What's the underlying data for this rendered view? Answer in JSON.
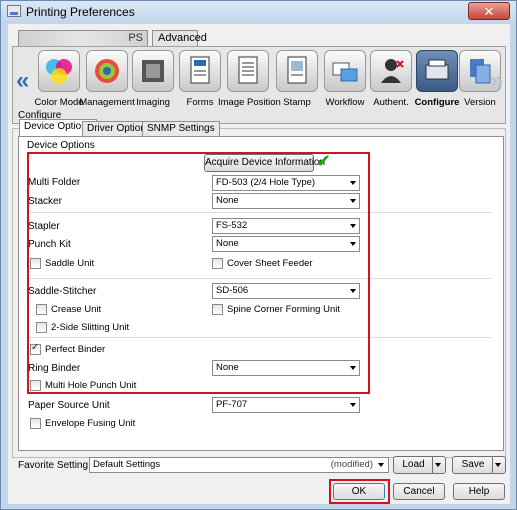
{
  "window": {
    "title": "Printing Preferences",
    "close_glyph": "✕"
  },
  "top_tabs": {
    "blurred_prefix": "",
    "ps_label": "PS",
    "advanced_label": "Advanced"
  },
  "toolbar": {
    "items": [
      {
        "label": "Color Mode",
        "icon": "color-mode-icon"
      },
      {
        "label": "Management",
        "icon": "management-icon"
      },
      {
        "label": "Imaging",
        "icon": "imaging-icon"
      },
      {
        "label": "Forms",
        "icon": "forms-icon"
      },
      {
        "label": "Image Position",
        "icon": "image-position-icon"
      },
      {
        "label": "Stamp",
        "icon": "stamp-icon"
      },
      {
        "label": "Workflow",
        "icon": "workflow-icon"
      },
      {
        "label": "Authent.",
        "icon": "authentication-icon"
      },
      {
        "label": "Configure",
        "icon": "configure-icon",
        "selected": true
      },
      {
        "label": "Version",
        "icon": "version-icon"
      }
    ]
  },
  "configure": {
    "section_label": "Configure",
    "tabs": [
      "Device Options",
      "Driver Options",
      "SNMP Settings"
    ],
    "group_label": "Device Options",
    "acquire_button": "Acquire Device Information",
    "fields": {
      "multi_folder": {
        "label": "Multi Folder",
        "value": "FD-503 (2/4 Hole Type)"
      },
      "stacker": {
        "label": "Stacker",
        "value": "None"
      },
      "stapler": {
        "label": "Stapler",
        "value": "FS-532"
      },
      "punch_kit": {
        "label": "Punch Kit",
        "value": "None"
      },
      "saddle_stitcher": {
        "label": "Saddle-Stitcher",
        "value": "SD-506"
      },
      "ring_binder": {
        "label": "Ring Binder",
        "value": "None"
      },
      "paper_source_unit": {
        "label": "Paper Source Unit",
        "value": "PF-707"
      }
    },
    "checks": {
      "saddle_unit": {
        "label": "Saddle Unit",
        "checked": false
      },
      "cover_sheet_feeder": {
        "label": "Cover Sheet Feeder",
        "checked": false
      },
      "crease_unit": {
        "label": "Crease Unit",
        "checked": false
      },
      "spine_corner": {
        "label": "Spine Corner Forming Unit",
        "checked": false
      },
      "slitting": {
        "label": "2-Side Slitting Unit",
        "checked": false
      },
      "perfect_binder": {
        "label": "Perfect Binder",
        "checked": true
      },
      "multi_hole_punch": {
        "label": "Multi Hole Punch Unit",
        "checked": false
      },
      "envelope_fusing": {
        "label": "Envelope Fusing Unit",
        "checked": false
      }
    }
  },
  "favorite": {
    "label": "Favorite Setting",
    "value": "Default Settings",
    "modified": "(modified)",
    "load": "Load",
    "save": "Save"
  },
  "dialog_buttons": {
    "ok": "OK",
    "cancel": "Cancel",
    "help": "Help"
  },
  "colors": {
    "highlight": "#d3151a",
    "accent": "#3b6db5",
    "ok_check": "#22a022"
  }
}
